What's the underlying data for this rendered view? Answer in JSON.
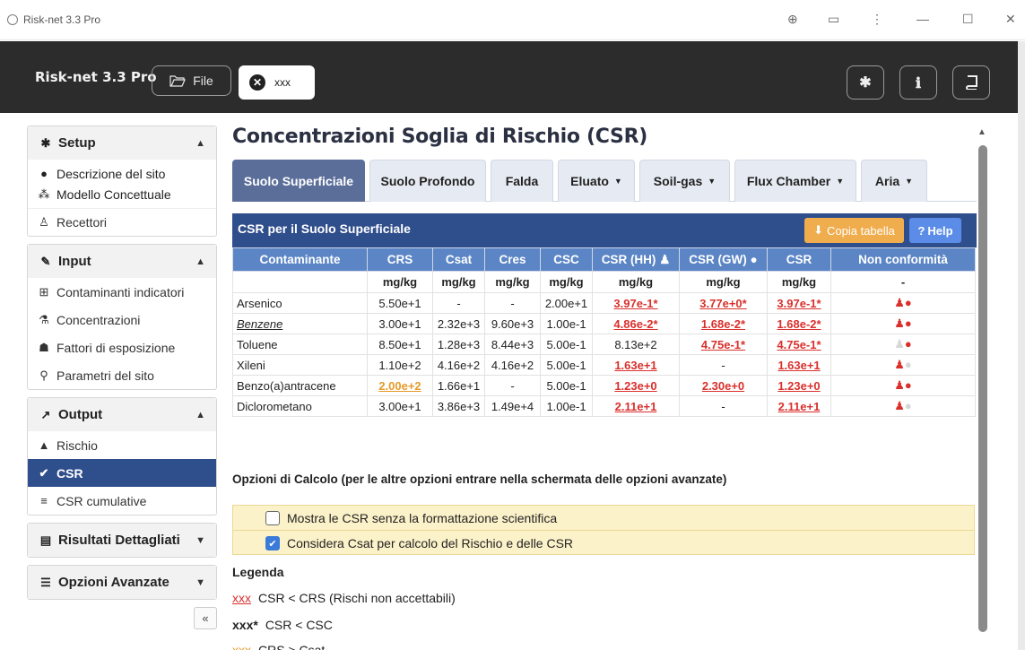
{
  "window": {
    "title": "Risk-net 3.3 Pro",
    "controls": [
      "⊕",
      "▭",
      "⋮",
      "—",
      "☐",
      "✕"
    ]
  },
  "header": {
    "brand": "Risk-net 3.3 Pro",
    "file_label": "File",
    "doc_tab_label": "xxx",
    "icons": [
      "gear-icon",
      "info-icon",
      "book-icon"
    ]
  },
  "sidebar": {
    "setup": {
      "title": "Setup",
      "items": [
        "Descrizione del sito",
        "Modello Concettuale",
        "Recettori"
      ]
    },
    "input": {
      "title": "Input",
      "items": [
        "Contaminanti indicatori",
        "Concentrazioni",
        "Fattori di esposizione",
        "Parametri del sito"
      ]
    },
    "output": {
      "title": "Output",
      "items": [
        "Rischio",
        "CSR",
        "CSR cumulative"
      ]
    },
    "risultati": {
      "title": "Risultati Dettagliati"
    },
    "opzioni": {
      "title": "Opzioni Avanzate"
    },
    "collapse": "«"
  },
  "main": {
    "title": "Concentrazioni Soglia di Rischio (CSR)",
    "tabs": [
      {
        "label": "Suolo Superficiale",
        "dropdown": false
      },
      {
        "label": "Suolo Profondo",
        "dropdown": false
      },
      {
        "label": "Falda",
        "dropdown": false
      },
      {
        "label": "Eluato",
        "dropdown": true
      },
      {
        "label": "Soil-gas",
        "dropdown": true
      },
      {
        "label": "Flux Chamber",
        "dropdown": true
      },
      {
        "label": "Aria",
        "dropdown": true
      }
    ],
    "table_title": "CSR per il Suolo Superficiale",
    "copy_label": "Copia tabella",
    "help_label": "Help",
    "columns": [
      "Contaminante",
      "CRS",
      "Csat",
      "Cres",
      "CSC",
      "CSR (HH)",
      "CSR (GW)",
      "CSR",
      "Non conformità"
    ],
    "units": [
      "",
      "mg/kg",
      "mg/kg",
      "mg/kg",
      "mg/kg",
      "mg/kg",
      "mg/kg",
      "mg/kg",
      "-"
    ],
    "rows": [
      {
        "name": "Arsenico",
        "crs": "5.50e+1",
        "csat": "-",
        "cres": "-",
        "csc": "2.00e+1",
        "hh": "3.97e-1*",
        "gw": "3.77e+0*",
        "csr": "3.97e-1*",
        "nc_person": true,
        "nc_drop": true
      },
      {
        "name": "Benzene",
        "crs": "3.00e+1",
        "csat": "2.32e+3",
        "cres": "9.60e+3",
        "csc": "1.00e-1",
        "hh": "4.86e-2*",
        "gw": "1.68e-2*",
        "csr": "1.68e-2*",
        "nc_person": true,
        "nc_drop": true
      },
      {
        "name": "Toluene",
        "crs": "8.50e+1",
        "csat": "1.28e+3",
        "cres": "8.44e+3",
        "csc": "5.00e-1",
        "hh": "8.13e+2",
        "gw": "4.75e-1*",
        "csr": "4.75e-1*",
        "nc_person": false,
        "nc_drop": true
      },
      {
        "name": "Xileni",
        "crs": "1.10e+2",
        "csat": "4.16e+2",
        "cres": "4.16e+2",
        "csc": "5.00e-1",
        "hh": "1.63e+1",
        "gw": "-",
        "csr": "1.63e+1",
        "nc_person": true,
        "nc_drop": false
      },
      {
        "name": "Benzo(a)antracene",
        "crs": "2.00e+2",
        "csat": "1.66e+1",
        "cres": "-",
        "csc": "5.00e-1",
        "hh": "1.23e+0",
        "gw": "2.30e+0",
        "csr": "1.23e+0",
        "nc_person": true,
        "nc_drop": true
      },
      {
        "name": "Diclorometano",
        "crs": "3.00e+1",
        "csat": "3.86e+3",
        "cres": "1.49e+4",
        "csc": "1.00e-1",
        "hh": "2.11e+1",
        "gw": "-",
        "csr": "2.11e+1",
        "nc_person": true,
        "nc_drop": false
      }
    ],
    "options_title": "Opzioni di Calcolo (per le altre opzioni entrare nella schermata delle opzioni avanzate)",
    "options": [
      {
        "label": "Mostra le CSR senza la formattazione scientifica",
        "checked": false
      },
      {
        "label": "Considera Csat per calcolo del Rischio e delle CSR",
        "checked": true
      }
    ],
    "legend_title": "Legenda",
    "legend": [
      {
        "sample": "xxx",
        "text": "CSR < CRS (Rischi non accettabili)"
      },
      {
        "sample": "xxx*",
        "text": "CSR < CSC"
      },
      {
        "sample": "xxx",
        "text": "CRS > Csat"
      }
    ]
  },
  "colors": {
    "accent": "#2f4e8c",
    "table_header": "#5b85c5",
    "exceed": "#d9302c",
    "warning": "#e79a28"
  }
}
